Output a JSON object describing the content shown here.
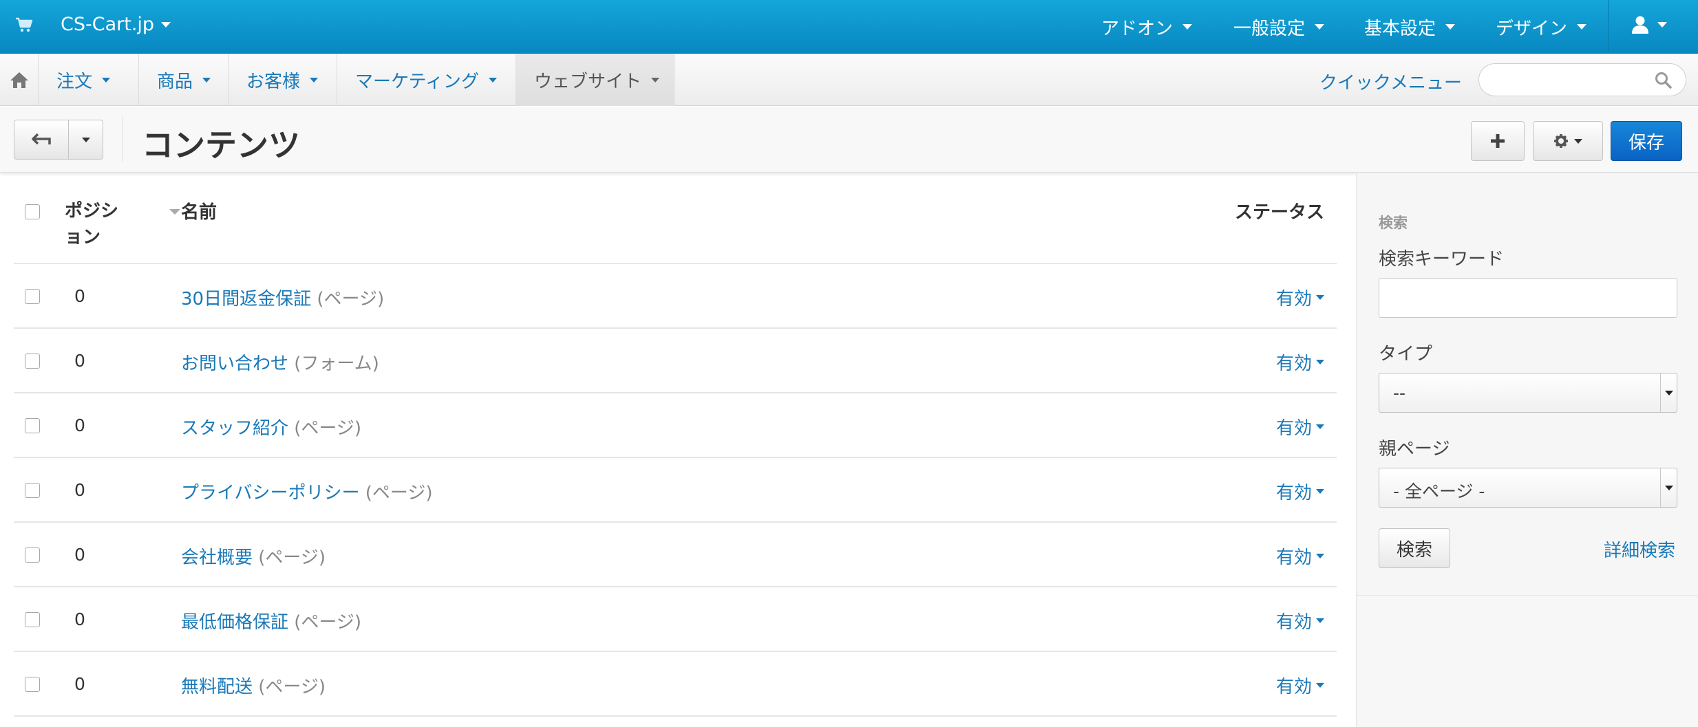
{
  "topbar": {
    "brand": "CS-Cart.jp",
    "menus": [
      "アドオン",
      "一般設定",
      "基本設定",
      "デザイン"
    ],
    "icons": {
      "cart": "cart-icon",
      "user": "user-icon"
    }
  },
  "nav": {
    "items": [
      "注文",
      "商品",
      "お客様",
      "マーケティング",
      "ウェブサイト"
    ],
    "active": "ウェブサイト",
    "quick_menu": "クイックメニュー",
    "search_placeholder": "",
    "icons": {
      "home": "home-icon",
      "search": "search-icon"
    }
  },
  "toolbar": {
    "title": "コンテンツ",
    "save_label": "保存",
    "icons": {
      "back": "back-arrow-icon",
      "add": "plus-icon",
      "settings": "gear-icon"
    }
  },
  "table": {
    "columns": {
      "position": "ポジション",
      "name": "名前",
      "status": "ステータス"
    },
    "rows": [
      {
        "position": "0",
        "name": "30日間返金保証",
        "type": "(ページ)",
        "status": "有効"
      },
      {
        "position": "0",
        "name": "お問い合わせ",
        "type": "(フォーム)",
        "status": "有効"
      },
      {
        "position": "0",
        "name": "スタッフ紹介",
        "type": "(ページ)",
        "status": "有効"
      },
      {
        "position": "0",
        "name": "プライバシーポリシー",
        "type": "(ページ)",
        "status": "有効"
      },
      {
        "position": "0",
        "name": "会社概要",
        "type": "(ページ)",
        "status": "有効"
      },
      {
        "position": "0",
        "name": "最低価格保証",
        "type": "(ページ)",
        "status": "有効"
      },
      {
        "position": "0",
        "name": "無料配送",
        "type": "(ページ)",
        "status": "有効"
      }
    ]
  },
  "sidebar": {
    "header": "検索",
    "keyword_label": "検索キーワード",
    "keyword_value": "",
    "type_label": "タイプ",
    "type_value": "--",
    "parent_label": "親ページ",
    "parent_value": "- 全ページ -",
    "search_button": "検索",
    "advanced_link": "詳細検索"
  },
  "colors": {
    "topbar": "#0a95cf",
    "link": "#1a79b8",
    "primary_button": "#0c6fd0"
  }
}
